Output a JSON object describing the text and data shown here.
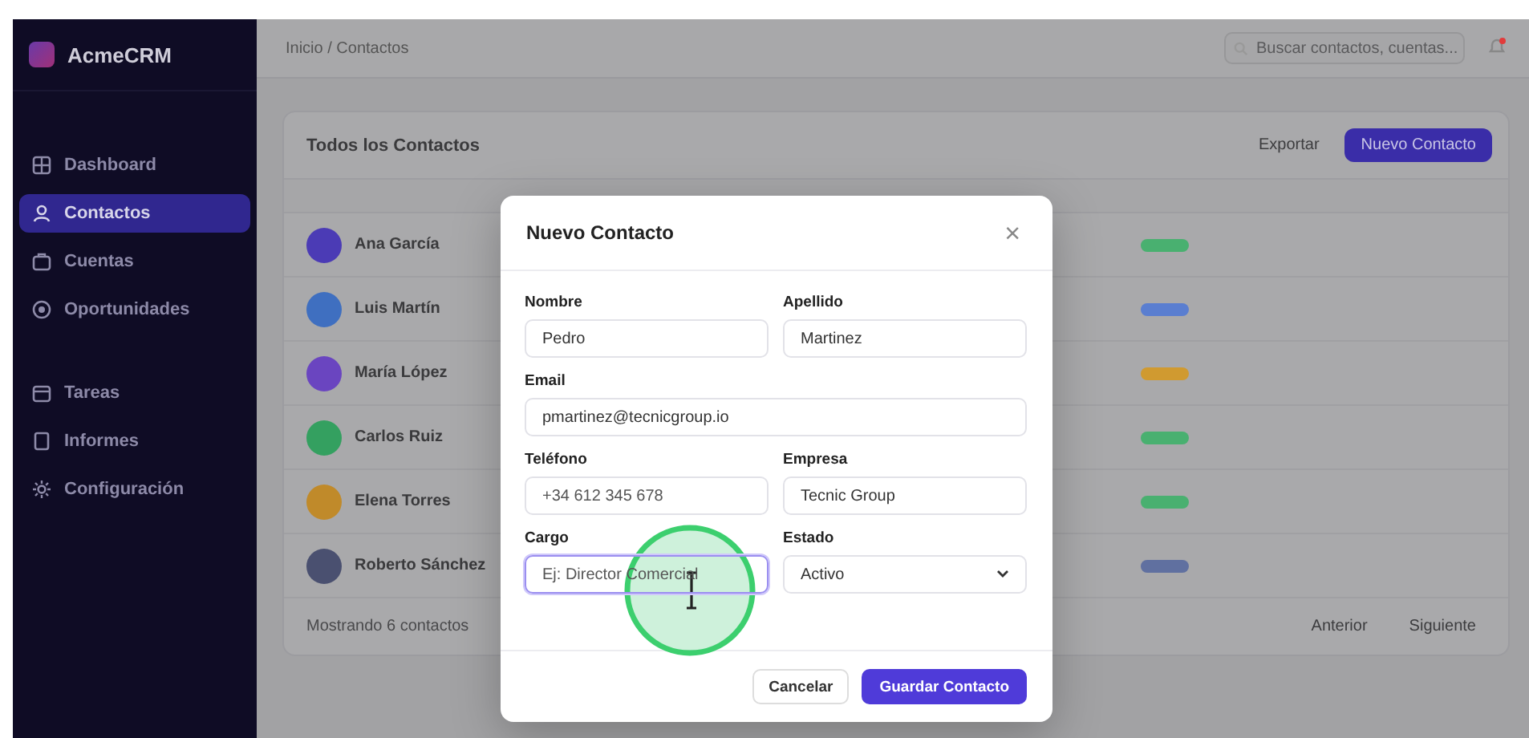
{
  "sidebar": {
    "brand": "AcmeCRM",
    "items": [
      {
        "label": "Dashboard",
        "selected": false
      },
      {
        "label": "Contactos",
        "selected": true
      },
      {
        "label": "Cuentas",
        "selected": false
      },
      {
        "label": "Oportunidades",
        "selected": false
      },
      {
        "label": "Tareas",
        "selected": false
      },
      {
        "label": "Informes",
        "selected": false
      },
      {
        "label": "Configuración",
        "selected": false
      }
    ]
  },
  "topbar": {
    "breadcrumb": "Inicio / Contactos",
    "search": {
      "placeholder": "Buscar contactos, cuentas..."
    }
  },
  "card": {
    "title": "Todos los Contactos",
    "export": "Exportar",
    "new": "Nuevo Contacto",
    "rows": [
      {
        "name": "Ana García",
        "avatar": {
          "color": "#4b3bb5"
        },
        "status": {
          "color": "#49b070"
        }
      },
      {
        "name": "Luis Martín",
        "avatar": {
          "color": "#3f6fc0"
        },
        "status": {
          "color": "#5a7ed0"
        }
      },
      {
        "name": "María López",
        "avatar": {
          "color": "#6a45c0"
        },
        "status": {
          "color": "#d09a30"
        }
      },
      {
        "name": "Carlos Ruiz",
        "avatar": {
          "color": "#34a060"
        },
        "status": {
          "color": "#49b070"
        }
      },
      {
        "name": "Elena Torres",
        "avatar": {
          "color": "#c08a2a"
        },
        "status": {
          "color": "#49b070"
        }
      },
      {
        "name": "Roberto Sánchez",
        "avatar": {
          "color": "#4a5070"
        },
        "status": {
          "color": "#6070a0"
        }
      }
    ],
    "footer": "Mostrando 6 contactos",
    "prev": "Anterior",
    "next": "Siguiente"
  },
  "modal": {
    "title": "Nuevo Contacto",
    "close": "×",
    "rows": [
      {
        "fields": [
          {
            "kind": "text",
            "label": "Nombre",
            "value": "Pedro",
            "focused": false
          },
          {
            "kind": "text",
            "label": "Apellido",
            "value": "Martinez",
            "focused": false
          }
        ]
      },
      {
        "fields": [
          {
            "kind": "text",
            "label": "Email",
            "value": "pmartinez@tecnicgroup.io",
            "focused": false
          }
        ]
      },
      {
        "fields": [
          {
            "kind": "text",
            "label": "Teléfono",
            "placeholder": "+34 612 345 678",
            "focused": false
          },
          {
            "kind": "text",
            "label": "Empresa",
            "value": "Tecnic Group",
            "focused": false
          }
        ]
      },
      {
        "fields": [
          {
            "kind": "text",
            "label": "Cargo",
            "placeholder": "Ej: Director Comercial",
            "focused": true
          },
          {
            "kind": "select",
            "label": "Estado",
            "value": "Activo",
            "focused": false
          }
        ]
      }
    ],
    "cancel": "Cancelar",
    "save": "Guardar Contacto"
  }
}
